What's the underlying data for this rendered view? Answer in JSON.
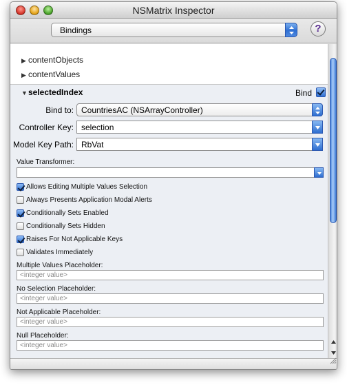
{
  "window": {
    "title": "NSMatrix Inspector"
  },
  "toolbar": {
    "pane_selector": "Bindings",
    "help_label": "?"
  },
  "bindings_list": {
    "collapsed": [
      "contentObjects",
      "contentValues"
    ],
    "expanded_name": "selectedIndex",
    "bind_label": "Bind",
    "bind_checked": true
  },
  "fields": {
    "bind_to_label": "Bind to:",
    "bind_to_value": "CountriesAC (NSArrayController)",
    "controller_key_label": "Controller Key:",
    "controller_key_value": "selection",
    "model_key_path_label": "Model Key Path:",
    "model_key_path_value": "RbVat",
    "value_transformer_label": "Value Transformer:",
    "value_transformer_value": ""
  },
  "options": [
    {
      "label": "Allows Editing Multiple Values Selection",
      "checked": true
    },
    {
      "label": "Always Presents Application Modal Alerts",
      "checked": false
    },
    {
      "label": "Conditionally Sets Enabled",
      "checked": true
    },
    {
      "label": "Conditionally Sets Hidden",
      "checked": false
    },
    {
      "label": "Raises For Not Applicable Keys",
      "checked": true
    },
    {
      "label": "Validates Immediately",
      "checked": false
    }
  ],
  "placeholders": [
    {
      "label": "Multiple Values Placeholder:",
      "value": "<integer value>"
    },
    {
      "label": "No Selection Placeholder:",
      "value": "<integer value>"
    },
    {
      "label": "Not Applicable Placeholder:",
      "value": "<integer value>"
    },
    {
      "label": "Null Placeholder:",
      "value": "<integer value>"
    }
  ]
}
